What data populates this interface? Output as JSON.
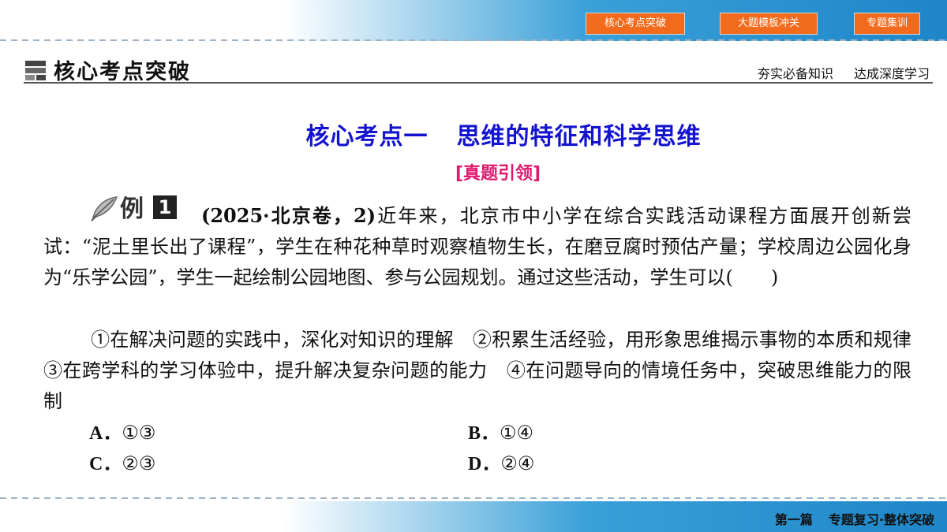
{
  "nav": {
    "buttons": [
      "核心考点突破",
      "大题模板冲关",
      "专题集训"
    ]
  },
  "section": {
    "title": "核心考点突破",
    "right_left": "夯实必备知识",
    "right_right": "达成深度学习"
  },
  "heading": {
    "main_left": "核心考点一",
    "main_right": "思维的特征和科学思维",
    "sub": "[真题引领]"
  },
  "example": {
    "label": "例",
    "number": "1",
    "source": "(2025·北京卷，2)",
    "stem": "近年来，北京市中小学在综合实践活动课程方面展开创新尝试：“泥土里长出了课程”，学生在种花种草时观察植物生长，在磨豆腐时预估产量；学校周边公园化身为“乐学公园”，学生一起绘制公园地图、参与公园规划。通过这些活动，学生可以(　　)",
    "statements": "①在解决问题的实践中，深化对知识的理解　②积累生活经验，用形象思维揭示事物的本质和规律　③在跨学科的学习体验中，提升解决复杂问题的能力　④在问题导向的情境任务中，突破思维能力的限制"
  },
  "choices": {
    "a_letter": "A．",
    "a_value": "①③",
    "b_letter": "B．",
    "b_value": "①④",
    "c_letter": "C．",
    "c_value": "②③",
    "d_letter": "D．",
    "d_value": "②④"
  },
  "footer": {
    "part": "第一篇",
    "title": "专题复习·整体突破"
  },
  "colors": {
    "nav_button": "#f26b1d",
    "heading": "#1414d0",
    "sub_heading": "#e0186e",
    "banner": "#1e86c8"
  }
}
